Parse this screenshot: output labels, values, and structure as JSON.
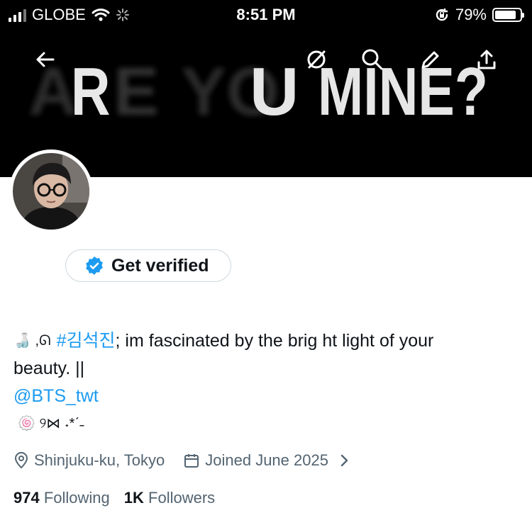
{
  "status_bar": {
    "carrier": "GLOBE",
    "time": "8:51 PM",
    "battery": "79%",
    "battery_level": 0.79
  },
  "header": {
    "banner_text": "ARE YOU MINE?",
    "actions": [
      "back-arrow-icon",
      "grok-icon",
      "search-icon",
      "edit-icon",
      "share-icon"
    ]
  },
  "profile": {
    "get_verified_label": "Get verified",
    "bio": {
      "emoji_prefix": "🍶 ,ᘏ",
      "hashtag": "#김석진",
      "text_line1": "; im fascinated by the brig ht light of your",
      "text_line2": "beauty. ||",
      "mention": "@BTS_twt",
      "deco_line": "🍥 ୨⋈ ˖*ˊ˗"
    },
    "location": "Shinjuku-ku, Tokyo",
    "joined": "Joined June 2025",
    "following_count": "974",
    "following_label": "Following",
    "followers_count": "1K",
    "followers_label": "Followers"
  },
  "colors": {
    "link": "#1d9bf0",
    "muted": "#536471",
    "text": "#0f1419",
    "verified": "#1d9bf0"
  }
}
